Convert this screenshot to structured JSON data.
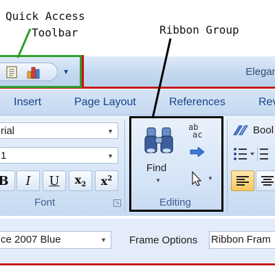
{
  "annotations": {
    "qat_line1": "Quick Access",
    "qat_line2": "Toolbar",
    "ribbon_group": "Ribbon Group"
  },
  "window": {
    "title": "Elegan"
  },
  "quick_access_toolbar": {
    "dropdown_glyph": "▾",
    "icons": [
      "document-icon",
      "chart-icon"
    ]
  },
  "tabs": [
    "Insert",
    "Page Layout",
    "References",
    "Rev"
  ],
  "font_group": {
    "font_name": "rial",
    "font_size": "1",
    "label": "Font",
    "buttons": {
      "bold": "B",
      "italic": "I",
      "underline": "U"
    }
  },
  "editing_group": {
    "find_label": "Find",
    "label": "Editing",
    "replace_glyph_top": "ab",
    "replace_glyph_bottom": "ac"
  },
  "styles_group": {
    "label": "Bool"
  },
  "bottom": {
    "theme_value": "ce 2007 Blue",
    "frame_options_label": "Frame Options",
    "frame_options_value": "Ribbon Fram"
  },
  "colors": {
    "annotation_green": "#2ca02c",
    "annotation_red": "#d01010",
    "ribbon_text": "#15428b"
  }
}
